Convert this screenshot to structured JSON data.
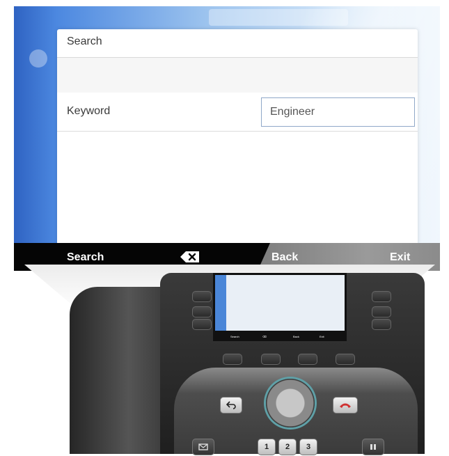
{
  "dialog": {
    "title": "Search",
    "keyword_label": "Keyword",
    "keyword_value": "Engineer"
  },
  "softkeys": {
    "search": "Search",
    "backspace_icon": "backspace-icon",
    "back": "Back",
    "exit": "Exit"
  },
  "phone": {
    "mini_softkeys": [
      "Search",
      "⌫",
      "Back",
      "Exit"
    ],
    "keypad": [
      "1",
      "2",
      "3"
    ],
    "hardware_icons": [
      "back-arrow-icon",
      "end-call-icon",
      "messages-icon",
      "hold-icon"
    ]
  },
  "colors": {
    "softkey_bar": "#050505",
    "screen_blue": "#2f63c2",
    "end_call_red": "#d03030"
  }
}
